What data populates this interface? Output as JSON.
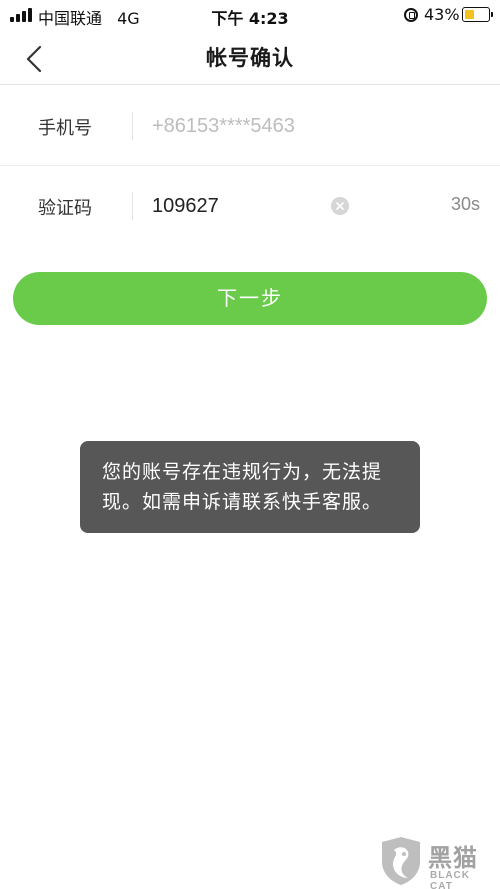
{
  "status_bar": {
    "carrier": "中国联通",
    "network": "4G",
    "time": "下午 4:23",
    "battery_percent": "43%",
    "battery_level": 0.43,
    "battery_color": "#f2c320"
  },
  "nav": {
    "back_icon": "chevron-left-icon",
    "title": "帐号确认"
  },
  "form": {
    "phone": {
      "label": "手机号",
      "placeholder": "+86153****5463"
    },
    "code": {
      "label": "验证码",
      "value": "109627",
      "clear_icon": "clear-circle-icon",
      "countdown": "30s"
    }
  },
  "next_button": {
    "label": "下一步",
    "color": "#6acb4b"
  },
  "toast": {
    "line1": "您的账号存在违规行为，无法提",
    "line2": "现。如需申诉请联系快手客服。"
  },
  "watermark": {
    "name_cn": "黑猫",
    "name_en": "BLACK CAT"
  }
}
